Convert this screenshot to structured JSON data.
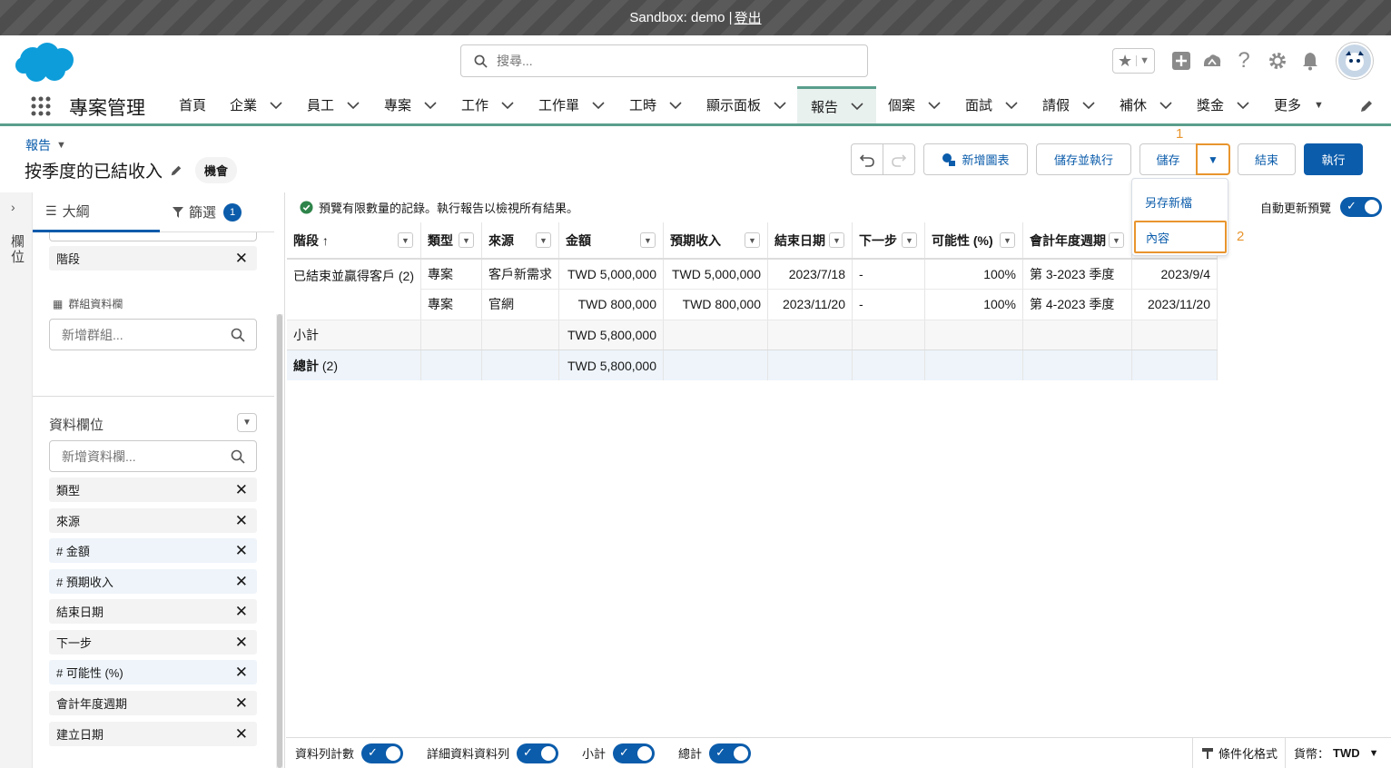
{
  "sandbox": {
    "text": "Sandbox: demo |",
    "logout": "登出"
  },
  "search": {
    "placeholder": "搜尋..."
  },
  "nav": {
    "app_name": "專案管理",
    "items": [
      {
        "label": "首頁"
      },
      {
        "label": "企業"
      },
      {
        "label": "員工"
      },
      {
        "label": "專案"
      },
      {
        "label": "工作"
      },
      {
        "label": "工作單"
      },
      {
        "label": "工時"
      },
      {
        "label": "顯示面板"
      },
      {
        "label": "報告"
      },
      {
        "label": "個案"
      },
      {
        "label": "面試"
      },
      {
        "label": "請假"
      },
      {
        "label": "補休"
      },
      {
        "label": "獎金"
      },
      {
        "label": "更多"
      }
    ],
    "active": "報告"
  },
  "report": {
    "breadcrumb": "報告",
    "title": "按季度的已結收入",
    "type_pill": "機會"
  },
  "toolbar": {
    "add_chart": "新增圖表",
    "save_and_run": "儲存並執行",
    "save": "儲存",
    "close": "結束",
    "run": "執行",
    "annotation_1": "1",
    "annotation_2": "2"
  },
  "dropdown": {
    "save_as": "另存新檔",
    "properties": "內容"
  },
  "rail": {
    "label": "欄位"
  },
  "panel": {
    "tab_outline": "大綱",
    "tab_filter": "篩選",
    "filter_count": "1",
    "group_rows_chip": "階段",
    "group_cols_title": "群組資料欄",
    "add_group_placeholder": "新增群組...",
    "columns_title": "資料欄位",
    "add_column_placeholder": "新增資料欄...",
    "columns": [
      "類型",
      "來源",
      "# 金額",
      "# 預期收入",
      "結束日期",
      "下一步",
      "# 可能性 (%)",
      "會計年度週期",
      "建立日期"
    ]
  },
  "info": {
    "message": "預覽有限數量的記錄。執行報告以檢視所有結果。",
    "auto_update": "自動更新預覽"
  },
  "table": {
    "headers": [
      "階段 ↑",
      "類型",
      "來源",
      "金額",
      "預期收入",
      "結束日期",
      "下一步",
      "可能性 (%)",
      "會計年度週期",
      ""
    ],
    "group": "已結束並贏得客戶 (2)",
    "rows": [
      [
        "專案",
        "客戶新需求",
        "TWD 5,000,000",
        "TWD 5,000,000",
        "2023/7/18",
        "-",
        "100%",
        "第 3-2023 季度",
        "2023/9/4"
      ],
      [
        "專案",
        "官網",
        "TWD 800,000",
        "TWD 800,000",
        "2023/11/20",
        "-",
        "100%",
        "第 4-2023 季度",
        "2023/11/20"
      ]
    ],
    "subtotal_label": "小計",
    "subtotal_amount": "TWD 5,800,000",
    "total_label": "總計",
    "total_count": "(2)",
    "total_amount": "TWD 5,800,000"
  },
  "footer": {
    "row_counts": "資料列計數",
    "detail_rows": "詳細資料資料列",
    "subtotals": "小計",
    "grand_total": "總計",
    "conditional_formatting": "條件化格式",
    "currency_label": "貨幣：",
    "currency_value": "TWD"
  },
  "colors": {
    "brand": "#0b5cab",
    "accent_annotation": "#e8952e",
    "nav_active": "#5a9e8c"
  }
}
